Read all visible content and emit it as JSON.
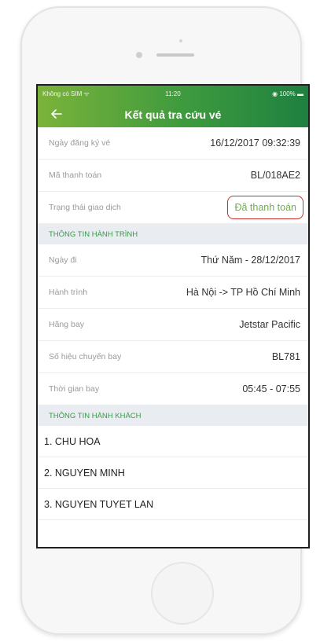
{
  "status_bar": {
    "carrier": "Không có SIM ᯤ",
    "time": "11:20",
    "battery": "◉ 100% ▬"
  },
  "header": {
    "back_icon": "back-arrow-icon",
    "title": "Kết quả tra cứu vé"
  },
  "details": [
    {
      "label": "Ngày đăng ký vé",
      "value": "16/12/2017 09:32:39"
    },
    {
      "label": "Mã thanh toán",
      "value": "BL/018AE2"
    },
    {
      "label": "Trạng thái giao dịch",
      "value": "Đã thanh toán"
    }
  ],
  "itinerary_section": "THÔNG TIN HÀNH TRÌNH",
  "itinerary": [
    {
      "label": "Ngày đi",
      "value": "Thứ Năm - 28/12/2017"
    },
    {
      "label": "Hành trình",
      "value": "Hà Nội -> TP Hồ Chí Minh"
    },
    {
      "label": "Hãng bay",
      "value": "Jetstar Pacific"
    },
    {
      "label": "Số hiệu chuyến bay",
      "value": "BL781"
    },
    {
      "label": "Thời gian bay",
      "value": "05:45 - 07:55"
    }
  ],
  "passenger_section": "THÔNG TIN HÀNH KHÁCH",
  "passengers": [
    "1. CHU HOA",
    "2. NGUYEN MINH",
    "3. NGUYEN TUYET LAN"
  ],
  "colors": {
    "header_start": "#7bb33a",
    "header_end": "#1e8040",
    "paid_status": "#6ab04c",
    "highlight_border": "#c9302c",
    "section_text": "#3a9a45",
    "section_bg": "#e9edf2"
  }
}
